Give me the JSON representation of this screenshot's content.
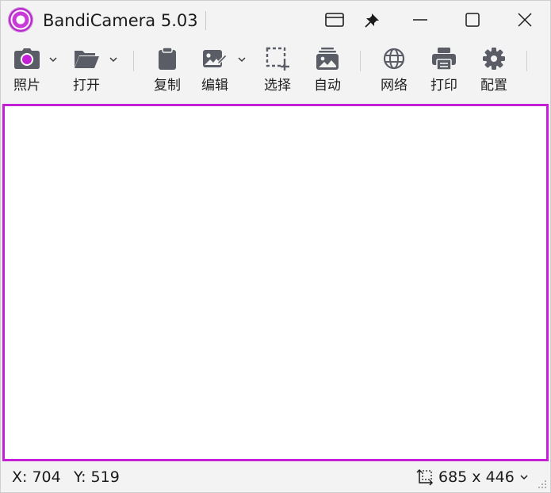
{
  "window": {
    "title": "BandiCamera 5.03",
    "accent_color": "#c520d8"
  },
  "titlebar_buttons": [
    {
      "name": "window-mode-icon"
    },
    {
      "name": "pin-icon"
    },
    {
      "name": "minimize-icon"
    },
    {
      "name": "maximize-icon"
    },
    {
      "name": "close-icon"
    }
  ],
  "toolbar": {
    "photo": {
      "label": "照片",
      "icon": "camera-icon"
    },
    "open": {
      "label": "打开",
      "icon": "folder-open-icon"
    },
    "copy": {
      "label": "复制",
      "icon": "clipboard-icon"
    },
    "edit": {
      "label": "编辑",
      "icon": "image-edit-icon"
    },
    "select": {
      "label": "选择",
      "icon": "select-region-icon"
    },
    "auto": {
      "label": "自动",
      "icon": "auto-capture-icon"
    },
    "network": {
      "label": "网络",
      "icon": "globe-icon"
    },
    "print": {
      "label": "打印",
      "icon": "printer-icon"
    },
    "settings": {
      "label": "配置",
      "icon": "gear-icon"
    }
  },
  "status": {
    "x_label": "X: 704",
    "y_label": "Y: 519",
    "size": "685 x 446"
  }
}
